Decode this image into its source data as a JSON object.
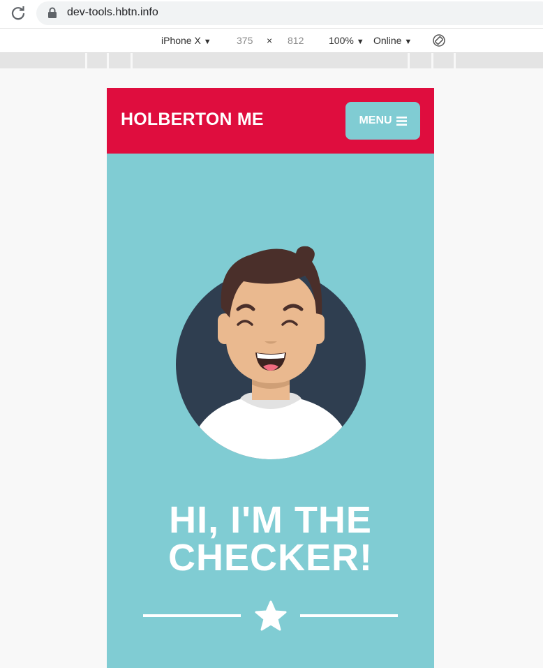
{
  "browser": {
    "url": "dev-tools.hbtn.info"
  },
  "device_toolbar": {
    "device": "iPhone X",
    "width": "375",
    "times": "×",
    "height": "812",
    "zoom": "100%",
    "network": "Online",
    "caret": "▼"
  },
  "page": {
    "brand": "HOLBERTON ME",
    "menu_label": "MENU",
    "headline_line1": "HI, I'M THE",
    "headline_line2": "CHECKER!"
  },
  "colors": {
    "nav_red": "#df0d3e",
    "teal": "#80ccd3",
    "avatar_circle": "#2f3e50"
  },
  "icons": [
    "reload-icon",
    "lock-icon",
    "rotate-icon",
    "hamburger-icon",
    "star-icon"
  ]
}
